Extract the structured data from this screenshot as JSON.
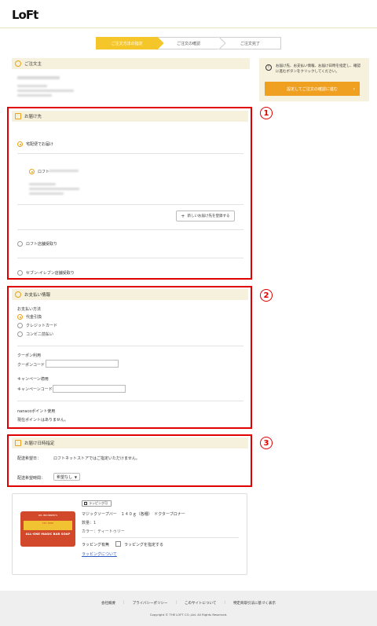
{
  "header": {
    "logo": "LoFt"
  },
  "steps": [
    "ご注文方法の指定",
    "ご注文の確認",
    "ご注文完了"
  ],
  "orderer": {
    "title": "ご注文主"
  },
  "sidebar": {
    "notice": "お届け先、お支払い情報、お届け日時を指定し、確認に進むボタンをクリックしてください。",
    "confirm_button": "設定してご注文の確認に進む",
    "accent": "#f0a020"
  },
  "delivery": {
    "title": "お届け先",
    "home_option": "宅配便でお届け",
    "address_name": "ロフト",
    "new_address_button": "新しいお届け先を登録する",
    "store_pickup": "ロフト店舗受取り",
    "seven_pickup": "セブン-イレブン店舗受取り"
  },
  "payment": {
    "title": "お支払い情報",
    "method_label": "お支払い方法",
    "methods": [
      "代金引換",
      "クレジットカード",
      "コンビニ前払い"
    ],
    "coupon_heading": "クーポン利用",
    "coupon_label": "クーポンコード：",
    "campaign_heading": "キャンペーン適用",
    "campaign_label": "キャンペーンコード：",
    "nanaco_heading": "nanacoポイント使用",
    "nanaco_text": "現在ポイントはありません。"
  },
  "schedule": {
    "title": "お届け日時指定",
    "date_label": "配送希望日：",
    "date_note": "ロフトネットストアではご指定いただけません。",
    "time_label": "配送希望時間：",
    "time_value": "希望なし"
  },
  "product": {
    "wrap_tag": "ラッピング可",
    "name": "マジックソープバー　１４０ｇ（各種）　ドクターブロナー",
    "qty": "数量：1",
    "color": "カラー：ティートゥリー",
    "wrap_label": "ラッピング有無",
    "wrap_check": "ラッピングを指定する",
    "wrap_link": "ラッピングについて",
    "soap_brand": "DR. BRONNER'S",
    "soap_top": "TEA TREE",
    "soap_main": "ALL-ONE MAGIC BAR SOAP"
  },
  "badges": [
    "1",
    "2",
    "3"
  ],
  "footer": {
    "links": [
      "会社概要",
      "プライバシーポリシー",
      "このサイトについて",
      "特定商取引法に基づく表示"
    ],
    "copyright": "Copyright © THE LOFT CO.,Ltd. All Rights Reserved."
  }
}
